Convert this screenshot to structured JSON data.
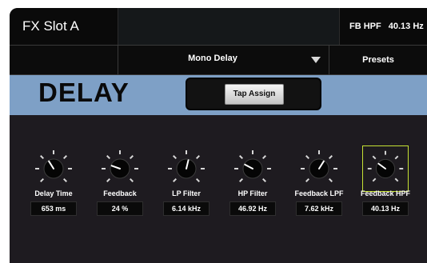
{
  "header": {
    "slot_title": "FX Slot A",
    "fb_hpf_label": "FB HPF",
    "fb_hpf_value": "40.13 Hz"
  },
  "selector": {
    "preset_name": "Mono Delay",
    "presets_label": "Presets"
  },
  "effect": {
    "name": "DELAY",
    "tap_assign_label": "Tap Assign"
  },
  "params": [
    {
      "label": "Delay Time",
      "value": "653 ms",
      "knob_fraction": 0.38,
      "selected": false
    },
    {
      "label": "Feedback",
      "value": "24 %",
      "knob_fraction": 0.24,
      "selected": false
    },
    {
      "label": "LP Filter",
      "value": "6.14 kHz",
      "knob_fraction": 0.55,
      "selected": false
    },
    {
      "label": "HP Filter",
      "value": "46.92 Hz",
      "knob_fraction": 0.27,
      "selected": false
    },
    {
      "label": "Feedback LPF",
      "value": "7.62 kHz",
      "knob_fraction": 0.62,
      "selected": false
    },
    {
      "label": "Feedback HPF",
      "value": "40.13 Hz",
      "knob_fraction": 0.3,
      "selected": true
    }
  ],
  "colors": {
    "header_band": "#7ea0c6",
    "selected_outline": "#c6e234"
  }
}
